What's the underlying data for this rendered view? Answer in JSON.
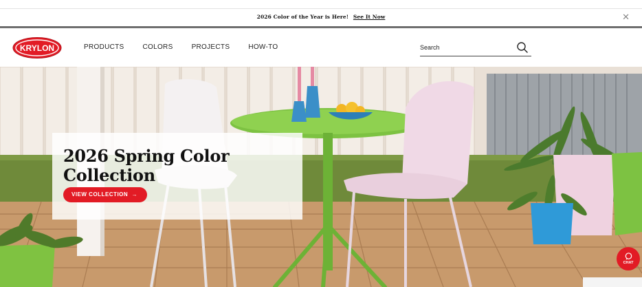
{
  "announcement": {
    "text": "2026 Color of the Year is Here!",
    "link": "See It Now",
    "close_icon": "close-icon"
  },
  "header": {
    "logo_text": "KRYLON",
    "nav": [
      {
        "label": "PRODUCTS"
      },
      {
        "label": "COLORS"
      },
      {
        "label": "PROJECTS"
      },
      {
        "label": "HOW-TO"
      }
    ],
    "search": {
      "placeholder": "Search",
      "icon": "search-icon"
    }
  },
  "hero": {
    "title": "2026 Spring Color Collection",
    "cta_label": "VIEW COLLECTION",
    "cta_icon": "arrow-right-icon"
  },
  "chat": {
    "label": "CHAT",
    "icon": "chat-bubble-icon"
  },
  "colors": {
    "brand_red": "#e21b25",
    "table_green": "#7dc242",
    "chair_pink": "#f0d9e6",
    "deck_tan": "#c89a6c"
  }
}
